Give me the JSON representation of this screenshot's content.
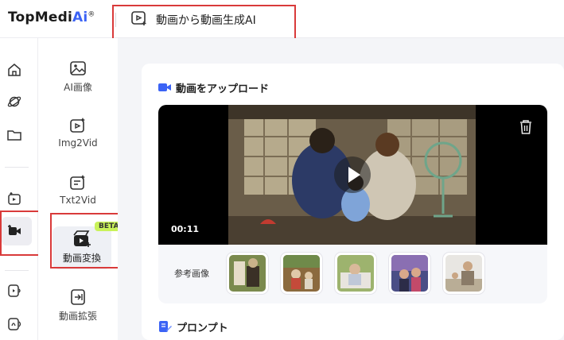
{
  "app": {
    "logo_main": "TopMedi",
    "logo_ai": "Ai",
    "logo_mark": "®",
    "page_title": "動画から動画生成AI"
  },
  "rail": {
    "icons": [
      "home-icon",
      "planet-icon",
      "folder-icon",
      "video-effect-icon",
      "video-camera-icon",
      "audio-video-icon",
      "sound-icon"
    ]
  },
  "subnav": {
    "items": [
      {
        "label": "AI画像",
        "icon": "image-icon"
      },
      {
        "label": "Img2Vid",
        "icon": "image-to-video-icon"
      },
      {
        "label": "Txt2Vid",
        "icon": "text-to-video-icon"
      },
      {
        "label": "動画変換",
        "icon": "video-convert-icon",
        "badge": "BETA"
      },
      {
        "label": "動画拡張",
        "icon": "video-extend-icon"
      }
    ]
  },
  "upload": {
    "section_title": "動画をアップロード",
    "video_time": "00:11",
    "reference_label": "参考画像",
    "reference_thumbs": 5
  },
  "prompt": {
    "section_title": "プロンプト"
  },
  "colors": {
    "accent": "#3b63f5",
    "badge": "#c9f25a",
    "highlight": "#d93a3a"
  }
}
